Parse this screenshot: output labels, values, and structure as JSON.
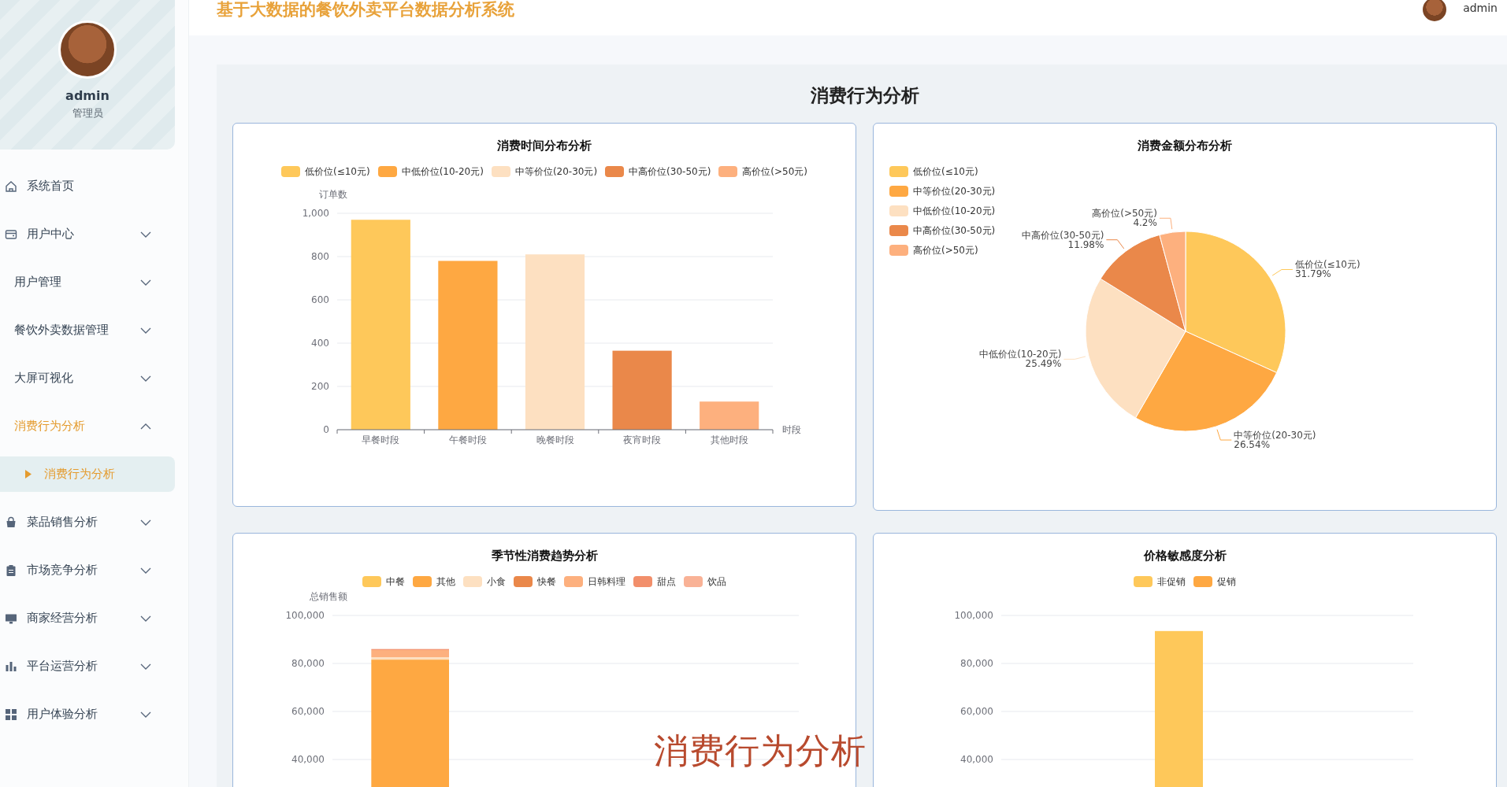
{
  "header": {
    "title": "基于大数据的餐饮外卖平台数据分析系统",
    "user": "admin"
  },
  "profile": {
    "name": "admin",
    "role": "管理员"
  },
  "menu": [
    {
      "label": "系统首页"
    },
    {
      "label": "用户中心",
      "expanded": false
    },
    {
      "label": "用户管理",
      "expanded": false
    },
    {
      "label": "餐饮外卖数据管理",
      "expanded": false
    },
    {
      "label": "大屏可视化",
      "expanded": false
    },
    {
      "label": "消费行为分析",
      "expanded": true,
      "children": [
        {
          "label": "消费行为分析",
          "selected": true
        }
      ]
    },
    {
      "label": "菜品销售分析",
      "expanded": false
    },
    {
      "label": "市场竞争分析",
      "expanded": false
    },
    {
      "label": "商家经营分析",
      "expanded": false
    },
    {
      "label": "平台运营分析",
      "expanded": false
    },
    {
      "label": "用户体验分析",
      "expanded": false
    }
  ],
  "page_title": "消费行为分析",
  "cards": [
    {
      "title": "消费时间分布分析",
      "legend": [
        {
          "label": "低价位(≤10元)",
          "color": "#fec85a"
        },
        {
          "label": "中低价位(10-20元)",
          "color": "#fea842"
        },
        {
          "label": "中等价位(20-30元)",
          "color": "#fde0c1"
        },
        {
          "label": "中高价位(30-50元)",
          "color": "#ea884a"
        },
        {
          "label": "高价位(>50元)",
          "color": "#fdb07e"
        }
      ],
      "chart_data": {
        "type": "bar",
        "xlabel": "时段",
        "ylabel": "订单数",
        "categories": [
          "早餐时段",
          "午餐时段",
          "晚餐时段",
          "夜宵时段",
          "其他时段"
        ],
        "values": [
          970,
          780,
          810,
          365,
          130
        ],
        "grid": true,
        "ylim": [
          0,
          1000
        ],
        "yticks": [
          0,
          200,
          400,
          600,
          800,
          {
            "value": 1000,
            "label": "1,000"
          }
        ]
      }
    },
    {
      "title": "消费金额分布分析",
      "legend": [
        {
          "label": "低价位(≤10元)",
          "color": "#fec85a"
        },
        {
          "label": "中等价位(20-30元)",
          "color": "#fea842"
        },
        {
          "label": "中低价位(10-20元)",
          "color": "#fde0c1"
        },
        {
          "label": "中高价位(30-50元)",
          "color": "#ea884a"
        },
        {
          "label": "高价位(>50元)",
          "color": "#fdb07e"
        }
      ],
      "chart_data": {
        "type": "pie",
        "categories": [
          "低价位(≤10元)",
          "中等价位(20-30元)",
          "中低价位(10-20元)",
          "中高价位(30-50元)",
          "高价位(>50元)"
        ],
        "values": [
          31.79,
          26.54,
          25.49,
          11.98,
          4.2
        ],
        "data_labels": true,
        "value_labels": [
          "31.79%",
          "26.54%",
          "25.49%",
          "11.98%",
          "4.2%"
        ]
      }
    },
    {
      "title": "季节性消费趋势分析",
      "chart_data": {
        "type": "bar",
        "stacked": true,
        "grid": true,
        "ylabel": "总销售额",
        "ylim": [
          0,
          100000
        ],
        "yticks": [
          {
            "value": 40000,
            "label": "40,000"
          },
          {
            "value": 60000,
            "label": "60,000"
          },
          {
            "value": 80000,
            "label": "80,000"
          },
          {
            "value": 100000,
            "label": "100,000"
          }
        ],
        "series": [
          {
            "name": "中餐",
            "color": "#fec85a",
            "values": [
              null
            ]
          },
          {
            "name": "其他",
            "color": "#fea842",
            "values": [
              81600
            ]
          },
          {
            "name": "小食",
            "color": "#fde0c1",
            "values": [
              1000
            ]
          },
          {
            "name": "快餐",
            "color": "#ea884a",
            "values": [
              null
            ]
          },
          {
            "name": "日韩料理",
            "color": "#fdb07e",
            "values": [
              3000
            ]
          },
          {
            "name": "甜点",
            "color": "#f28f6b",
            "values": [
              400
            ]
          },
          {
            "name": "饮品",
            "color": "#f9b296",
            "values": [
              null
            ]
          }
        ]
      }
    },
    {
      "title": "价格敏感度分析",
      "chart_data": {
        "type": "bar",
        "grid": true,
        "ylim": [
          0,
          100000
        ],
        "yticks": [
          {
            "value": 40000,
            "label": "40,000"
          },
          {
            "value": 60000,
            "label": "60,000"
          },
          {
            "value": 80000,
            "label": "80,000"
          },
          {
            "value": 100000,
            "label": "100,000"
          }
        ],
        "series": [
          {
            "name": "非促销",
            "color": "#fec85a",
            "values": [
              93500
            ]
          },
          {
            "name": "促销",
            "color": "#fea842",
            "values": [
              null
            ]
          }
        ]
      }
    }
  ],
  "caption": "消费行为分析"
}
